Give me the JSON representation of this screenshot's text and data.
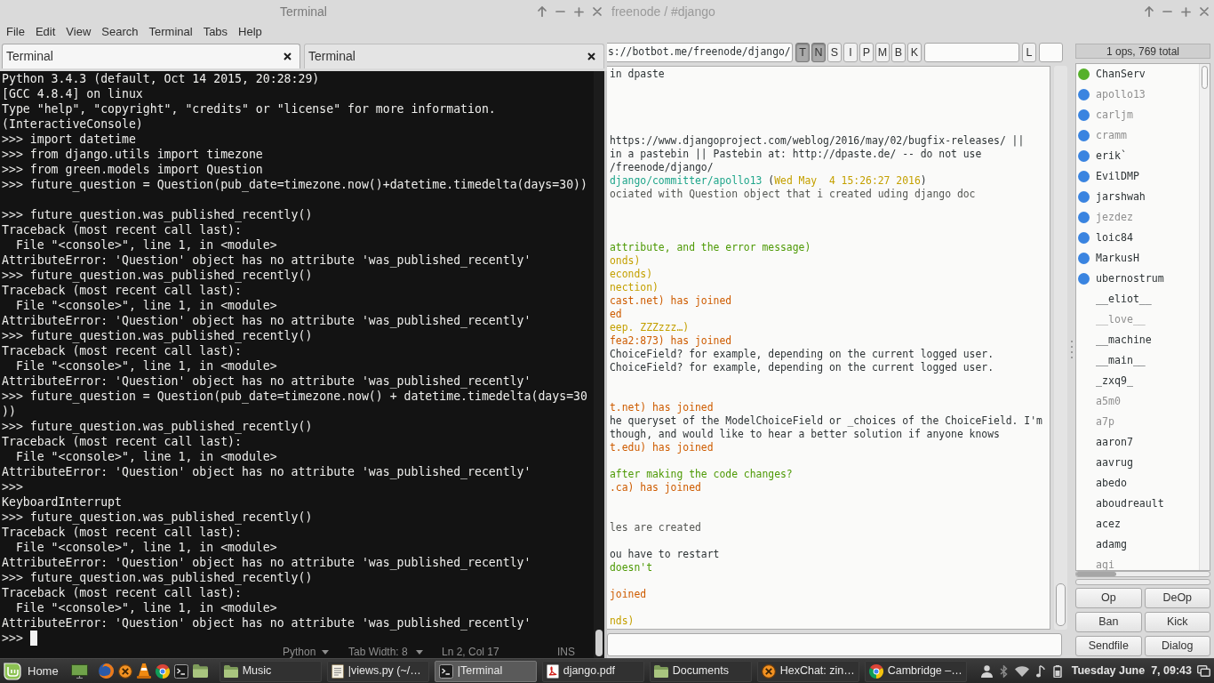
{
  "terminal": {
    "title": "Terminal",
    "menu": [
      "File",
      "Edit",
      "View",
      "Search",
      "Terminal",
      "Tabs",
      "Help"
    ],
    "tabs": [
      {
        "label": "Terminal",
        "selected": true
      },
      {
        "label": "Terminal",
        "selected": false
      }
    ],
    "lines": [
      {
        "kind": "text",
        "text": "Python 3.4.3 (default, Oct 14 2015, 20:28:29)"
      },
      {
        "kind": "text",
        "text": "[GCC 4.8.4] on linux"
      },
      {
        "kind": "text",
        "text": "Type \"help\", \"copyright\", \"credits\" or \"license\" for more information."
      },
      {
        "kind": "text",
        "text": "(InteractiveConsole)"
      },
      {
        "kind": "text",
        "text": ">>> import datetime"
      },
      {
        "kind": "text",
        "text": ">>> from django.utils import timezone"
      },
      {
        "kind": "text",
        "text": ">>> from green.models import Question"
      },
      {
        "kind": "text",
        "text": ">>> future_question = Question(pub_date=timezone.now()+datetime.timedelta(days=30))"
      },
      {
        "kind": "blank"
      },
      {
        "kind": "text",
        "text": ">>> future_question.was_published_recently()"
      },
      {
        "kind": "text",
        "text": "Traceback (most recent call last):"
      },
      {
        "kind": "text",
        "text": "  File \"<console>\", line 1, in <module>"
      },
      {
        "kind": "text",
        "text": "AttributeError: 'Question' object has no attribute 'was_published_recently'"
      },
      {
        "kind": "text",
        "text": ">>> future_question.was_published_recently()"
      },
      {
        "kind": "text",
        "text": "Traceback (most recent call last):"
      },
      {
        "kind": "text",
        "text": "  File \"<console>\", line 1, in <module>"
      },
      {
        "kind": "text",
        "text": "AttributeError: 'Question' object has no attribute 'was_published_recently'"
      },
      {
        "kind": "text",
        "text": ">>> future_question.was_published_recently()"
      },
      {
        "kind": "text",
        "text": "Traceback (most recent call last):"
      },
      {
        "kind": "text",
        "text": "  File \"<console>\", line 1, in <module>"
      },
      {
        "kind": "text",
        "text": "AttributeError: 'Question' object has no attribute 'was_published_recently'"
      },
      {
        "kind": "text",
        "text": ">>> future_question = Question(pub_date=timezone.now() + datetime.timedelta(days=30))"
      },
      {
        "kind": "text",
        "text": ">>> future_question.was_published_recently()"
      },
      {
        "kind": "text",
        "text": "Traceback (most recent call last):"
      },
      {
        "kind": "text",
        "text": "  File \"<console>\", line 1, in <module>"
      },
      {
        "kind": "text",
        "text": "AttributeError: 'Question' object has no attribute 'was_published_recently'"
      },
      {
        "kind": "text",
        "text": ">>>"
      },
      {
        "kind": "text",
        "text": "KeyboardInterrupt"
      },
      {
        "kind": "text",
        "text": ">>> future_question.was_published_recently()"
      },
      {
        "kind": "text",
        "text": "Traceback (most recent call last):"
      },
      {
        "kind": "text",
        "text": "  File \"<console>\", line 1, in <module>"
      },
      {
        "kind": "text",
        "text": "AttributeError: 'Question' object has no attribute 'was_published_recently'"
      },
      {
        "kind": "text",
        "text": ">>> future_question.was_published_recently()"
      },
      {
        "kind": "text",
        "text": "Traceback (most recent call last):"
      },
      {
        "kind": "text",
        "text": "  File \"<console>\", line 1, in <module>"
      },
      {
        "kind": "text",
        "text": "AttributeError: 'Question' object has no attribute 'was_published_recently'"
      }
    ],
    "prompt": ">>>",
    "editor_status": {
      "language": "Python",
      "tab_width": "Tab Width: 8",
      "position": "Ln 2, Col 17",
      "mode": "INS"
    }
  },
  "hexchat": {
    "title": "freenode / #django",
    "topic": "s://botbot.me/freenode/django/",
    "mode_buttons": [
      {
        "label": "T",
        "on": true
      },
      {
        "label": "N",
        "on": true
      },
      {
        "label": "S",
        "on": false
      },
      {
        "label": "I",
        "on": false
      },
      {
        "label": "P",
        "on": false
      },
      {
        "label": "M",
        "on": false
      },
      {
        "label": "B",
        "on": false
      },
      {
        "label": "K",
        "on": false
      }
    ],
    "limit_button": "L",
    "chat_lines": [
      {
        "kind": "message",
        "text": "in dpaste",
        "color": "#2e3436"
      },
      {
        "kind": "covered"
      },
      {
        "kind": "covered"
      },
      {
        "kind": "covered"
      },
      {
        "kind": "covered"
      },
      {
        "kind": "message",
        "text": "https://www.djangoproject.com/weblog/2016/may/02/bugfix-releases/ ||",
        "color": "#2e3436"
      },
      {
        "kind": "message",
        "text": "in a pastebin || Pastebin at: http://dpaste.de/ -- do not use",
        "color": "#2e3436"
      },
      {
        "kind": "message",
        "text": "/freenode/django/",
        "color": "#2e3436"
      },
      {
        "kind": "mixed",
        "segments": [
          {
            "text": "django/committer/apollo13",
            "color": "#1ea58a"
          },
          {
            "text": " ("
          },
          {
            "text": "Wed May  4 15:26:27 2016",
            "color": "#c4a000"
          },
          {
            "text": ")"
          }
        ]
      },
      {
        "kind": "message",
        "text": "ociated with Question object that i created uding django doc",
        "color": "#555753"
      },
      {
        "kind": "covered"
      },
      {
        "kind": "covered"
      },
      {
        "kind": "covered"
      },
      {
        "kind": "message",
        "text": "attribute, and the error message)",
        "color": "#4e9a06"
      },
      {
        "kind": "message",
        "text": "onds)",
        "color": "#c4a000"
      },
      {
        "kind": "message",
        "text": "econds)",
        "color": "#c4a000"
      },
      {
        "kind": "message",
        "text": "nection)",
        "color": "#c4a000"
      },
      {
        "kind": "message",
        "text": "cast.net) has joined",
        "color": "#ce5c00"
      },
      {
        "kind": "message",
        "text": "ed",
        "color": "#ce5c00"
      },
      {
        "kind": "message",
        "text": "eep. ZZZzzz…)",
        "color": "#c4a000"
      },
      {
        "kind": "message",
        "text": "fea2:873) has joined",
        "color": "#ce5c00"
      },
      {
        "kind": "message",
        "text": "ChoiceField? for example, depending on the current logged user.",
        "color": "#2e3436"
      },
      {
        "kind": "message",
        "text": "ChoiceField? for example, depending on the current logged user.",
        "color": "#2e3436"
      },
      {
        "kind": "covered"
      },
      {
        "kind": "covered"
      },
      {
        "kind": "message",
        "text": "t.net) has joined",
        "color": "#ce5c00"
      },
      {
        "kind": "message",
        "text": "he queryset of the ModelChoiceField or _choices of the ChoiceField. I'm",
        "color": "#2e3436"
      },
      {
        "kind": "message",
        "text": "though, and would like to hear a better solution if anyone knows",
        "color": "#2e3436"
      },
      {
        "kind": "message",
        "text": "t.edu) has joined",
        "color": "#ce5c00"
      },
      {
        "kind": "covered"
      },
      {
        "kind": "message",
        "text": "after making the code changes?",
        "color": "#4e9a06"
      },
      {
        "kind": "message",
        "text": ".ca) has joined",
        "color": "#ce5c00"
      },
      {
        "kind": "covered"
      },
      {
        "kind": "covered"
      },
      {
        "kind": "message",
        "text": "les are created",
        "color": "#555753"
      },
      {
        "kind": "covered"
      },
      {
        "kind": "message",
        "text": "ou have to restart",
        "color": "#2e3436"
      },
      {
        "kind": "message",
        "text": "doesn't",
        "color": "#4e9a06"
      },
      {
        "kind": "covered"
      },
      {
        "kind": "message",
        "text": "joined",
        "color": "#ce5c00"
      },
      {
        "kind": "covered"
      },
      {
        "kind": "message",
        "text": "nds)",
        "color": "#c4a000"
      }
    ],
    "user_count": "1 ops, 769 total",
    "users": [
      {
        "nick": "ChanServ",
        "color": "#56b02a",
        "away": false
      },
      {
        "nick": "apollo13",
        "color": "#3a84e0",
        "away": true
      },
      {
        "nick": "carljm",
        "color": "#3a84e0",
        "away": true
      },
      {
        "nick": "cramm",
        "color": "#3a84e0",
        "away": true
      },
      {
        "nick": "erik`",
        "color": "#3a84e0",
        "away": false
      },
      {
        "nick": "EvilDMP",
        "color": "#3a84e0",
        "away": false
      },
      {
        "nick": "jarshwah",
        "color": "#3a84e0",
        "away": false
      },
      {
        "nick": "jezdez",
        "color": "#3a84e0",
        "away": true
      },
      {
        "nick": "loic84",
        "color": "#3a84e0",
        "away": false
      },
      {
        "nick": "MarkusH",
        "color": "#3a84e0",
        "away": false
      },
      {
        "nick": "ubernostrum",
        "color": "#3a84e0",
        "away": false
      },
      {
        "nick": "__eliot__",
        "away": false
      },
      {
        "nick": "__love__",
        "away": true
      },
      {
        "nick": "__machine",
        "away": false
      },
      {
        "nick": "__main__",
        "away": false
      },
      {
        "nick": "_zxq9_",
        "away": false
      },
      {
        "nick": "a5m0",
        "away": true
      },
      {
        "nick": "a7p",
        "away": true
      },
      {
        "nick": "aaron7",
        "away": false
      },
      {
        "nick": "aavrug",
        "away": false
      },
      {
        "nick": "abedo",
        "away": false
      },
      {
        "nick": "aboudreault",
        "away": false
      },
      {
        "nick": "acez",
        "away": false
      },
      {
        "nick": "adamg",
        "away": false
      },
      {
        "nick": "agi",
        "away": true
      }
    ],
    "meter": {
      "level": 0
    },
    "buttons": [
      "Op",
      "DeOp",
      "Ban",
      "Kick",
      "Sendfile",
      "Dialog"
    ]
  },
  "taskbar": {
    "menu_label": "Home",
    "windows": [
      {
        "label": "Music",
        "kind": "folder",
        "selected": false
      },
      {
        "label": "|views.py (~/…",
        "kind": "editor",
        "selected": false
      },
      {
        "label": "|Terminal",
        "kind": "terminal",
        "selected": true
      },
      {
        "label": "django.pdf",
        "kind": "pdf",
        "selected": false
      },
      {
        "label": "Documents",
        "kind": "folder",
        "selected": false
      },
      {
        "label": "HexChat: zin…",
        "kind": "chat",
        "selected": false
      },
      {
        "label": "Cambridge –…",
        "kind": "browser",
        "selected": false
      }
    ],
    "clock": "Tuesday June  7, 09:43"
  }
}
